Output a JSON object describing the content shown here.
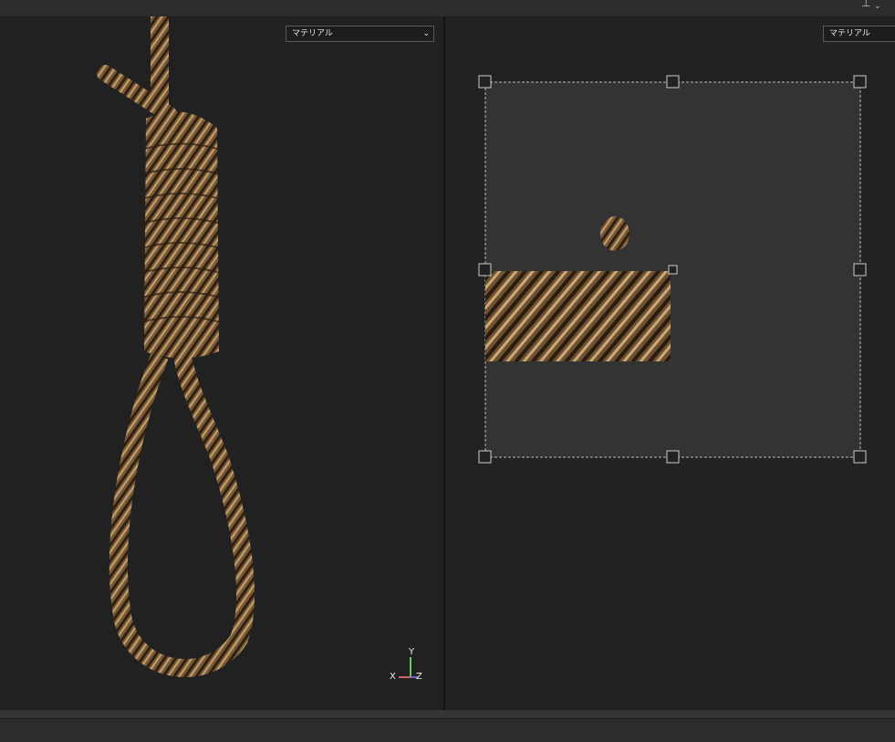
{
  "viewport3d": {
    "channel_dropdown": "マテリアル",
    "axes": {
      "x": "X",
      "y": "Y",
      "z": "Z"
    }
  },
  "viewport2d": {
    "channel_dropdown": "マテリアル"
  },
  "colors": {
    "rope": "#7a5a36",
    "rope_dark": "#3a2a18",
    "rope_light": "#c9a877",
    "uv_bg": "#333333"
  },
  "icons": [
    "pin-icon",
    "chevron-down-icon"
  ]
}
